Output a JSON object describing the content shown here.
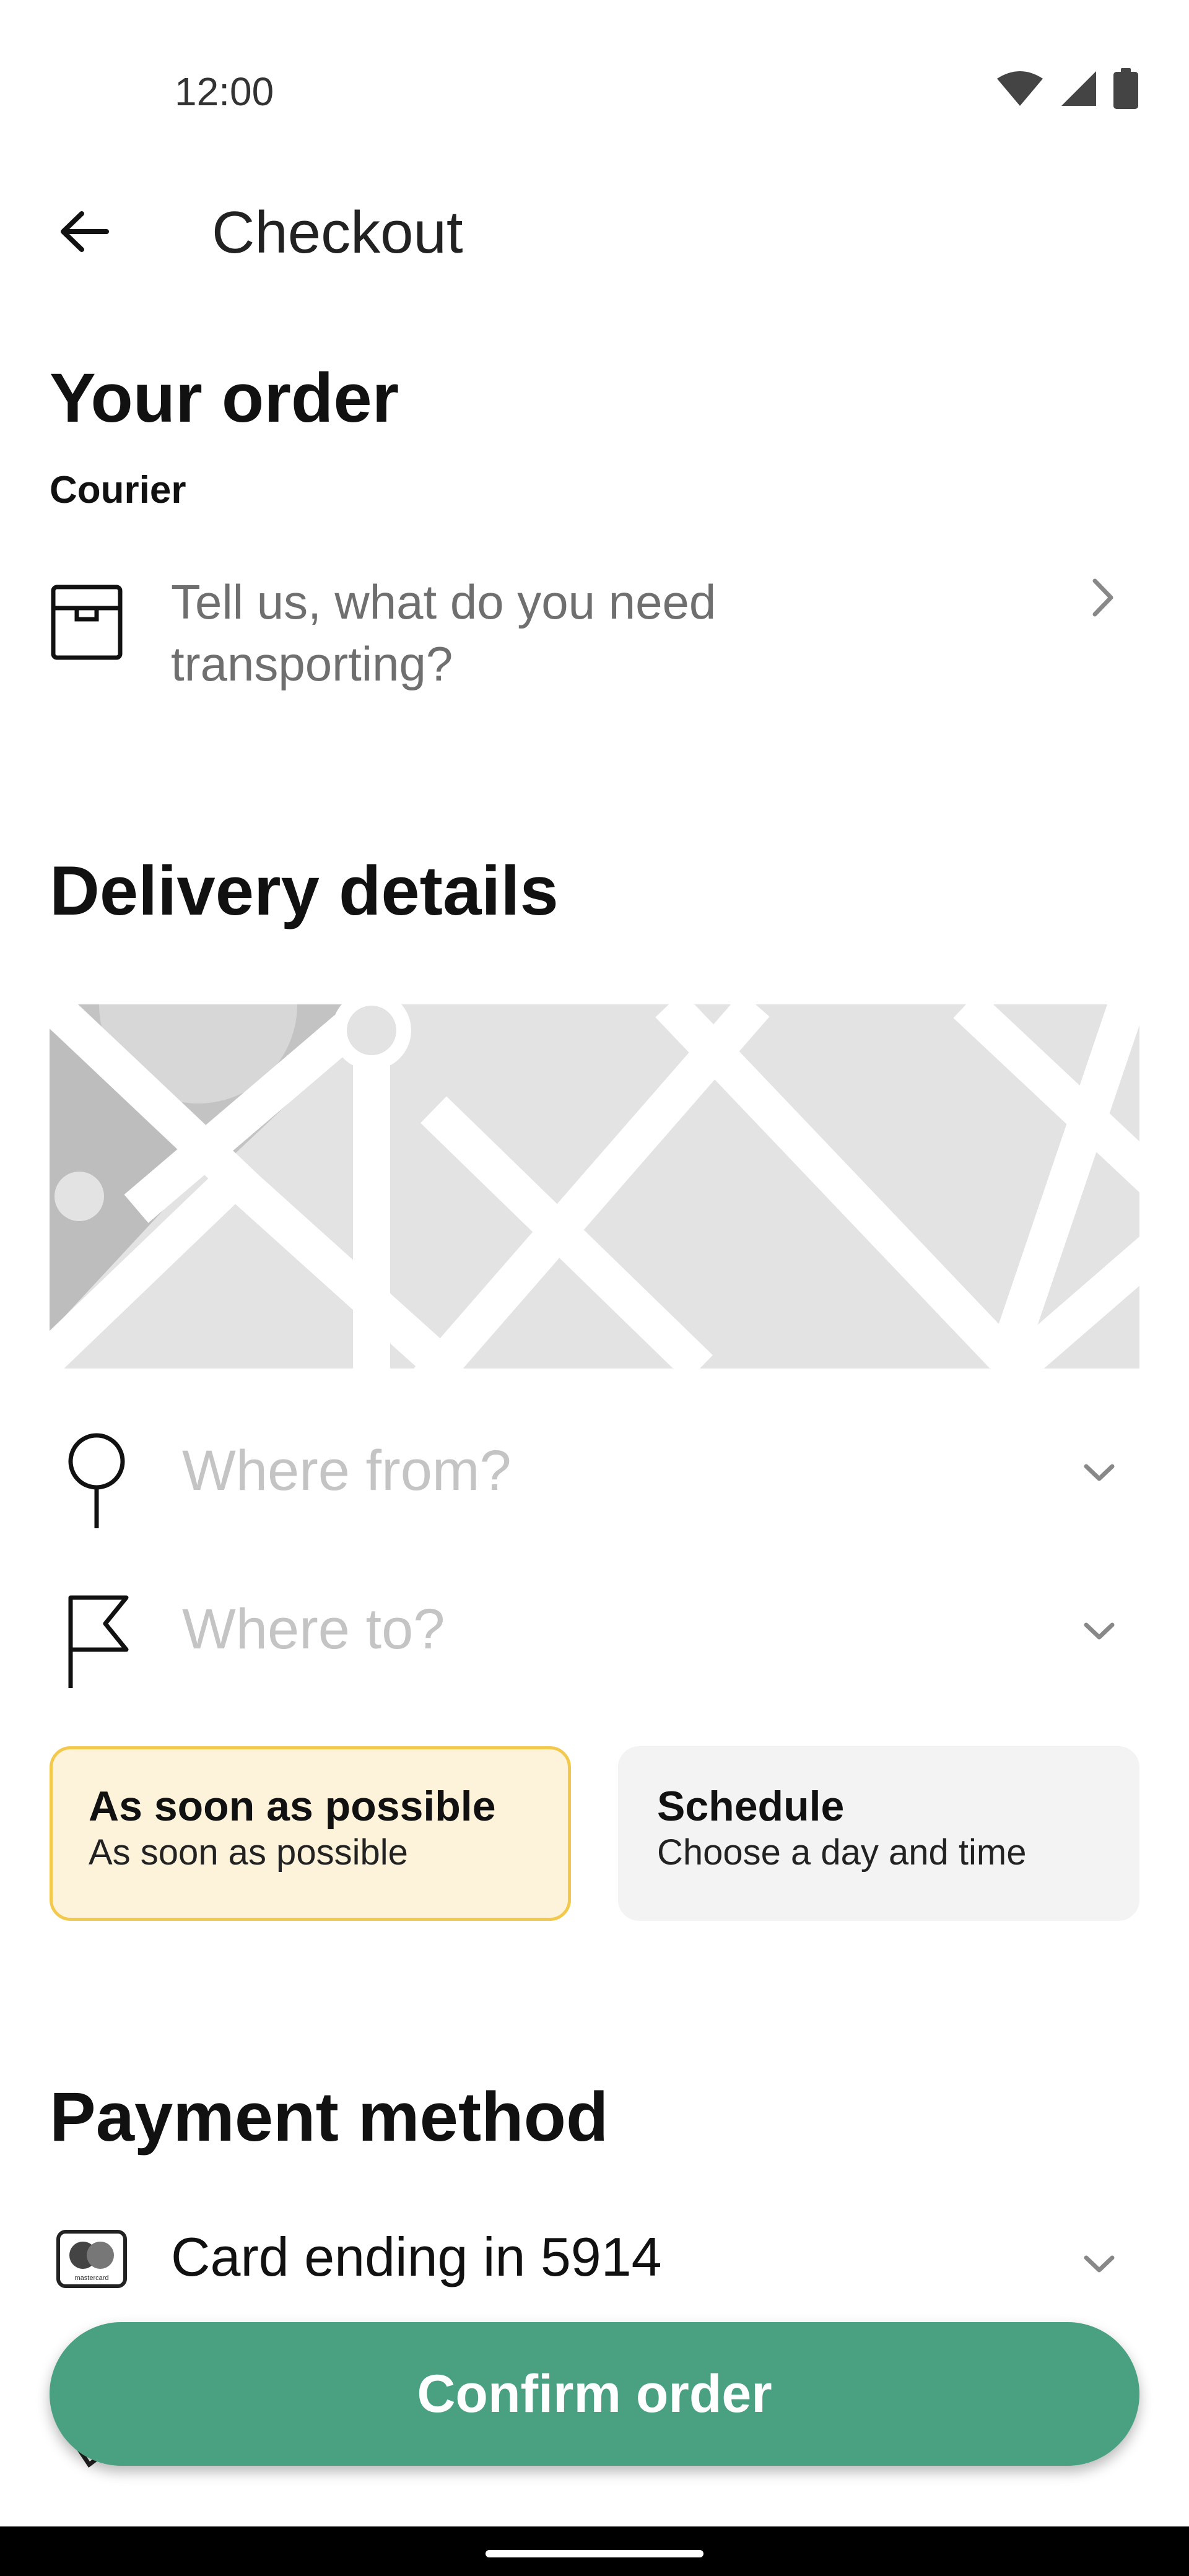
{
  "status_bar": {
    "time": "12:00",
    "icons": [
      "wifi-icon",
      "signal-icon",
      "battery-icon"
    ]
  },
  "header": {
    "back_icon": "arrow-left-icon",
    "title": "Checkout"
  },
  "order": {
    "heading": "Your order",
    "service_label": "Courier",
    "item_prompt": "Tell us, what do you need transporting?",
    "item_icon": "box-icon",
    "chevron_icon": "chevron-right-icon"
  },
  "delivery": {
    "heading": "Delivery details",
    "from_placeholder": "Where from?",
    "to_placeholder": "Where to?",
    "from_icon": "pin-icon",
    "to_icon": "flag-icon",
    "time_options": [
      {
        "title": "As soon as possible",
        "subtitle": "As soon as possible",
        "selected": true
      },
      {
        "title": "Schedule",
        "subtitle": "Choose a day and time",
        "selected": false
      }
    ]
  },
  "payment": {
    "heading": "Payment method",
    "card_label": "Card ending in 5914",
    "card_icon": "mastercard-icon",
    "card_icon_text": "mastercard"
  },
  "actions": {
    "confirm_label": "Confirm order"
  },
  "colors": {
    "accent": "#4aa182",
    "selected_card_bg": "#fdf2da",
    "selected_card_border": "#f2c94c",
    "placeholder_text": "#c4c4c4"
  }
}
